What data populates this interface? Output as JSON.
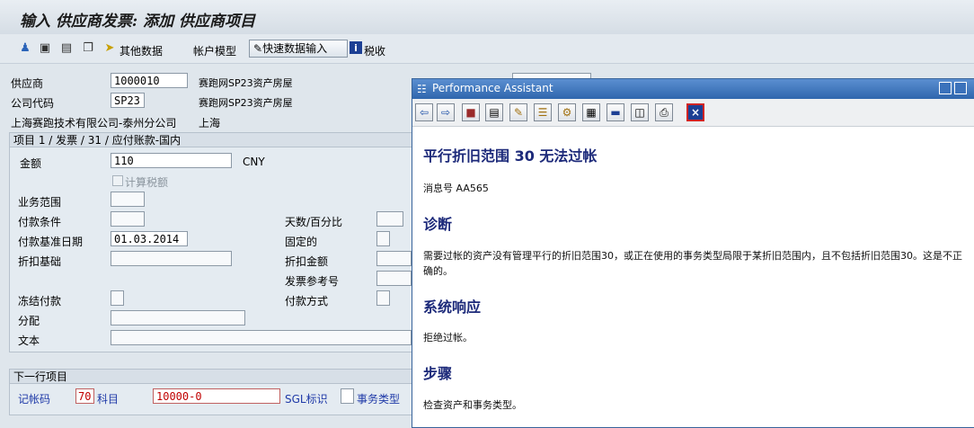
{
  "window": {
    "title": "输入 供应商发票: 添加 供应商项目"
  },
  "toolbar": {
    "other_data_label": "其他数据",
    "account_model_label": "帐户模型",
    "fast_entry_label": "快速数据输入",
    "tax_label": "税收"
  },
  "header": {
    "vendor_label": "供应商",
    "vendor_value": "1000010",
    "vendor_name": "赛跑网SP23资产房屋",
    "company_code_label": "公司代码",
    "company_code_value": "SP23",
    "company_code_name": "赛跑网SP23资产房屋",
    "company_full_name": "上海赛跑技术有限公司-泰州分公司",
    "city": "上海"
  },
  "item": {
    "group_title": "项目 1 / 发票 / 31 / 应付账款-国内",
    "amount_label": "金额",
    "amount_value": "110",
    "currency": "CNY",
    "calc_tax_label": "计算税额",
    "business_area_label": "业务范围",
    "payment_terms_label": "付款条件",
    "days_percent_label": "天数/百分比",
    "baseline_date_label": "付款基准日期",
    "baseline_date_value": "01.03.2014",
    "fixed_label": "固定的",
    "discount_base_label": "折扣基础",
    "discount_amount_label": "折扣金额",
    "invoice_ref_label": "发票参考号",
    "payment_block_label": "冻结付款",
    "payment_method_label": "付款方式",
    "assignment_label": "分配",
    "text_label": "文本"
  },
  "next_item": {
    "group_title": "下一行项目",
    "posting_key_label": "记帐码",
    "posting_key_value": "70",
    "account_label": "科目",
    "account_value": "10000-0",
    "sgl_label": "SGL标识",
    "trans_type_label": "事务类型"
  },
  "performance_assistant": {
    "title": "Performance Assistant",
    "heading": "平行折旧范围  30 无法过帐",
    "message_no": "消息号  AA565",
    "diagnosis_heading": "诊断",
    "diagnosis_text": "需要过帐的资产没有管理平行的折旧范围30，或正在使用的事务类型局限于某折旧范围内，且不包括折旧范围30。这是不正确的。",
    "response_heading": "系统响应",
    "response_text": "拒绝过帐。",
    "steps_heading": "步骤",
    "steps_text": "检查资产和事务类型。"
  },
  "colors": {
    "titlebar_blue": "#2f66ad",
    "heading_navy": "#1d2a7a"
  }
}
